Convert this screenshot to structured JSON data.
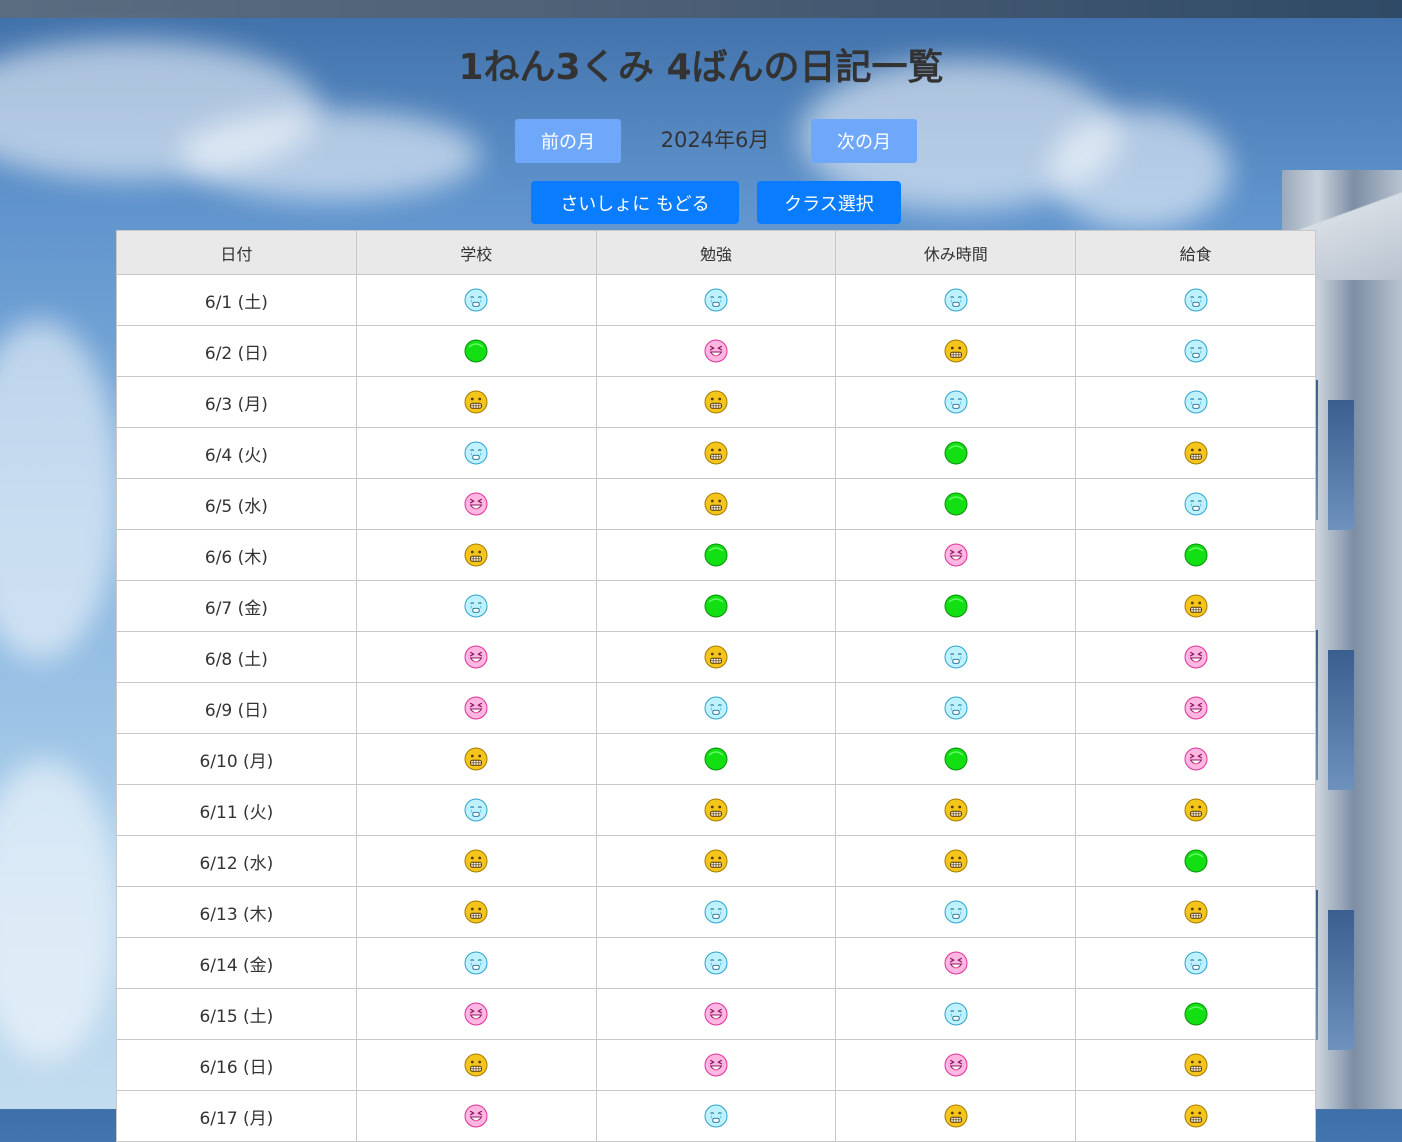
{
  "page": {
    "title": "1ねん3くみ 4ばんの日記一覧",
    "prev_month_label": "前の月",
    "current_month": "2024年6月",
    "next_month_label": "次の月",
    "back_to_start_label": "さいしょに もどる",
    "class_select_label": "クラス選択"
  },
  "table": {
    "headers": [
      "日付",
      "学校",
      "勉強",
      "休み時間",
      "給食"
    ],
    "rows": [
      {
        "date": "6/1 (土)",
        "moods": [
          "cry",
          "cry",
          "cry",
          "cry"
        ]
      },
      {
        "date": "6/2 (日)",
        "moods": [
          "green",
          "laugh",
          "grin",
          "cry"
        ]
      },
      {
        "date": "6/3 (月)",
        "moods": [
          "grin",
          "grin",
          "cry",
          "cry"
        ]
      },
      {
        "date": "6/4 (火)",
        "moods": [
          "cry",
          "grin",
          "green",
          "grin"
        ]
      },
      {
        "date": "6/5 (水)",
        "moods": [
          "laugh",
          "grin",
          "green",
          "cry"
        ]
      },
      {
        "date": "6/6 (木)",
        "moods": [
          "grin",
          "green",
          "laugh",
          "green"
        ]
      },
      {
        "date": "6/7 (金)",
        "moods": [
          "cry",
          "green",
          "green",
          "grin"
        ]
      },
      {
        "date": "6/8 (土)",
        "moods": [
          "laugh",
          "grin",
          "cry",
          "laugh"
        ]
      },
      {
        "date": "6/9 (日)",
        "moods": [
          "laugh",
          "cry",
          "cry",
          "laugh"
        ]
      },
      {
        "date": "6/10 (月)",
        "moods": [
          "grin",
          "green",
          "green",
          "laugh"
        ]
      },
      {
        "date": "6/11 (火)",
        "moods": [
          "cry",
          "grin",
          "grin",
          "grin"
        ]
      },
      {
        "date": "6/12 (水)",
        "moods": [
          "grin",
          "grin",
          "grin",
          "green"
        ]
      },
      {
        "date": "6/13 (木)",
        "moods": [
          "grin",
          "cry",
          "cry",
          "grin"
        ]
      },
      {
        "date": "6/14 (金)",
        "moods": [
          "cry",
          "cry",
          "laugh",
          "cry"
        ]
      },
      {
        "date": "6/15 (土)",
        "moods": [
          "laugh",
          "laugh",
          "cry",
          "green"
        ]
      },
      {
        "date": "6/16 (日)",
        "moods": [
          "grin",
          "laugh",
          "laugh",
          "grin"
        ]
      },
      {
        "date": "6/17 (月)",
        "moods": [
          "laugh",
          "cry",
          "grin",
          "grin"
        ]
      }
    ]
  },
  "icons": {
    "grin": "grinning-face-icon",
    "cry": "crying-face-icon",
    "laugh": "laughing-face-icon",
    "green": "green-circle-icon"
  },
  "colors": {
    "month_button": "#6fa8fb",
    "primary_button": "#0a7cff",
    "header_bg": "#e9e9e9"
  }
}
